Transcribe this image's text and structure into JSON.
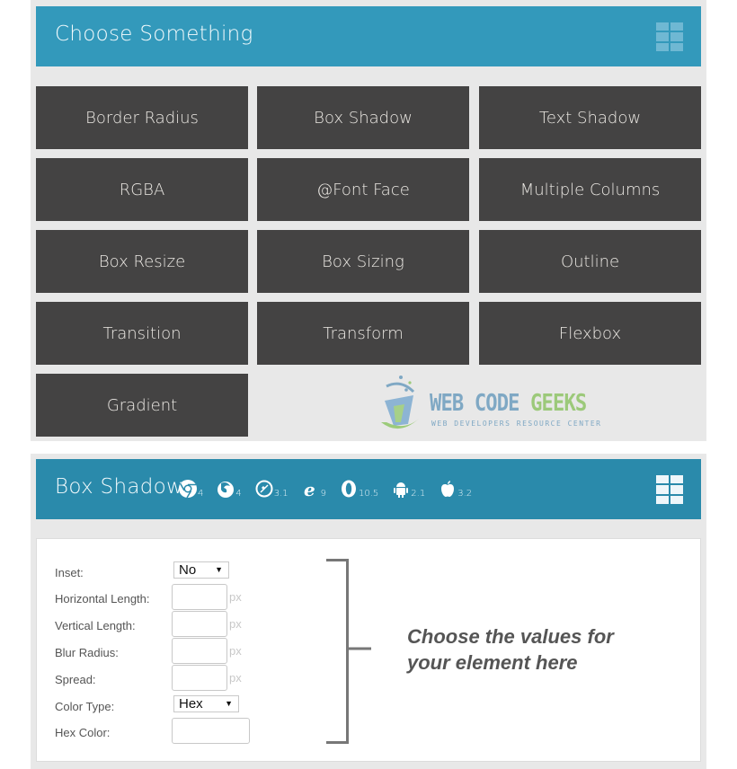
{
  "chooser": {
    "title": "Choose Something",
    "menu_icon": "grid-menu-icon",
    "tiles": [
      {
        "label": "Border Radius"
      },
      {
        "label": "Box Shadow"
      },
      {
        "label": "Text Shadow"
      },
      {
        "label": "RGBA"
      },
      {
        "label": "@Font Face"
      },
      {
        "label": "Multiple Columns"
      },
      {
        "label": "Box Resize"
      },
      {
        "label": "Box Sizing"
      },
      {
        "label": "Outline"
      },
      {
        "label": "Transition"
      },
      {
        "label": "Transform"
      },
      {
        "label": "Flexbox"
      },
      {
        "label": "Gradient"
      }
    ],
    "logo": {
      "name_part1": "WEB CODE ",
      "name_part2": "GEEKS",
      "tagline": "WEB DEVELOPERS RESOURCE CENTER"
    }
  },
  "editor": {
    "title": "Box Shadow",
    "menu_icon": "grid-menu-icon",
    "browser_support": [
      {
        "icon": "chrome-icon",
        "version": "4"
      },
      {
        "icon": "firefox-icon",
        "version": "4"
      },
      {
        "icon": "safari-icon",
        "version": "3.1"
      },
      {
        "icon": "ie-icon",
        "version": "9"
      },
      {
        "icon": "opera-icon",
        "version": "10.5"
      },
      {
        "icon": "android-icon",
        "version": "2.1"
      },
      {
        "icon": "apple-icon",
        "version": "3.2"
      }
    ],
    "form": {
      "inset": {
        "label": "Inset:",
        "value": "No"
      },
      "horizontal_length": {
        "label": "Horizontal Length:",
        "value": "",
        "unit": "px"
      },
      "vertical_length": {
        "label": "Vertical Length:",
        "value": "",
        "unit": "px"
      },
      "blur_radius": {
        "label": "Blur Radius:",
        "value": "",
        "unit": "px"
      },
      "spread": {
        "label": "Spread:",
        "value": "",
        "unit": "px"
      },
      "color_type": {
        "label": "Color Type:",
        "value": "Hex"
      },
      "hex_color": {
        "label": "Hex Color:",
        "value": ""
      }
    },
    "hint_line1": "Choose the values for",
    "hint_line2": "your element here"
  },
  "colors": {
    "header_top": "#3399bb",
    "header_bottom": "#2a8aab",
    "tile": "#444343",
    "panel": "#e8e8e8"
  }
}
